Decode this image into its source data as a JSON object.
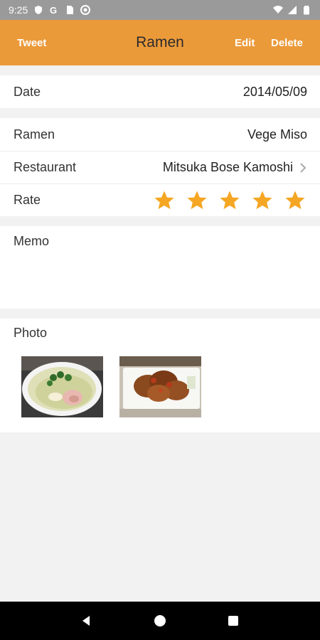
{
  "status_bar": {
    "time": "9:25",
    "icons_left": [
      "shield-icon",
      "google-icon",
      "sim-card-icon",
      "settings-circle-icon"
    ],
    "icons_right": [
      "wifi-icon",
      "signal-icon",
      "battery-icon"
    ]
  },
  "app_bar": {
    "title": "Ramen",
    "tweet_label": "Tweet",
    "edit_label": "Edit",
    "delete_label": "Delete",
    "background_color": "#eb9a3a"
  },
  "date_row": {
    "label": "Date",
    "value": "2014/05/09"
  },
  "details": {
    "ramen": {
      "label": "Ramen",
      "value": "Vege Miso"
    },
    "restaurant": {
      "label": "Restaurant",
      "value": "Mitsuka Bose Kamoshi"
    },
    "rate": {
      "label": "Rate",
      "rating": 5,
      "max": 5,
      "star_color": "#f5a623"
    }
  },
  "memo": {
    "label": "Memo",
    "text": ""
  },
  "photos": {
    "label": "Photo",
    "items": [
      {
        "name": "ramen-bowl-photo"
      },
      {
        "name": "karaage-plate-photo"
      }
    ]
  },
  "nav_bar": {
    "buttons": [
      "back-icon",
      "home-icon",
      "recents-icon"
    ]
  }
}
